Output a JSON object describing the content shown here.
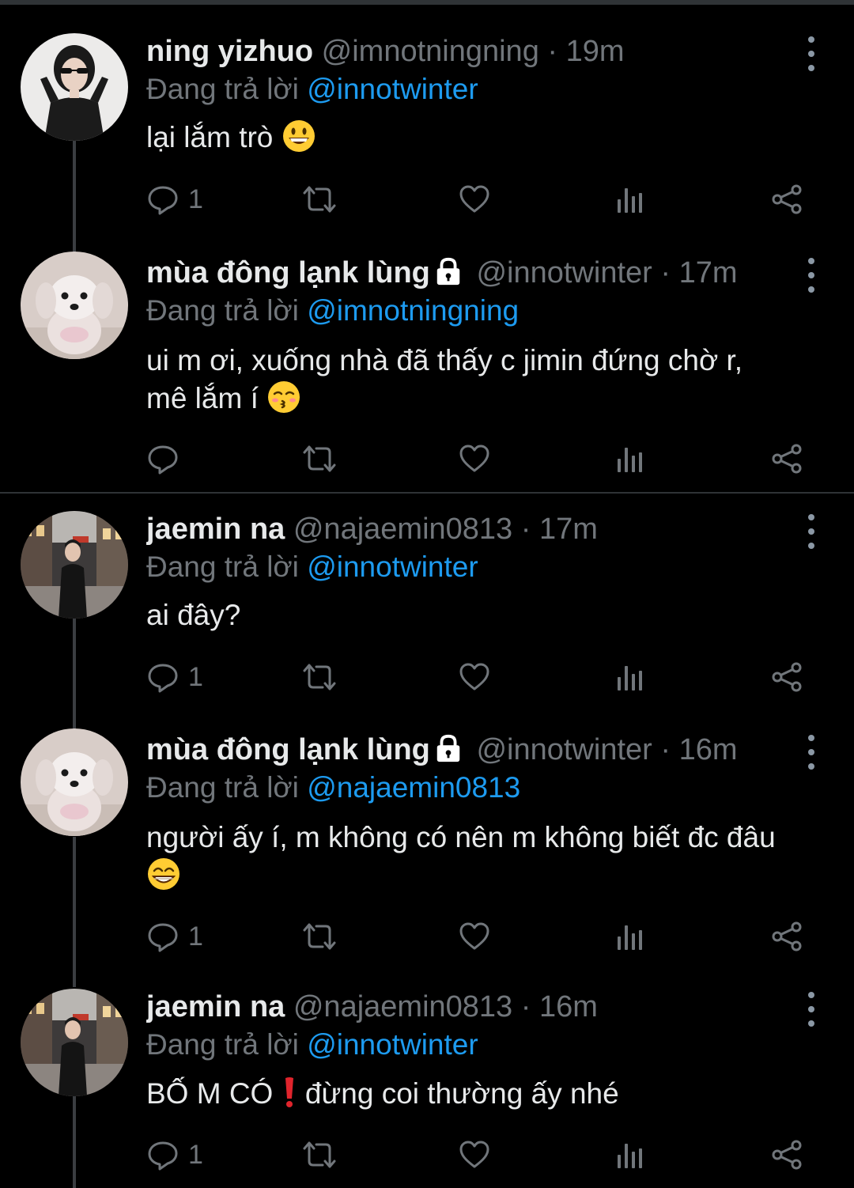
{
  "replying_prefix": "Đang trả lời",
  "colors": {
    "background": "#000000",
    "text": "#e7e9ea",
    "muted": "#71767b",
    "link": "#1d9bf0"
  },
  "tweets": [
    {
      "name": "ning yizhuo",
      "handle": "@imnotningning",
      "separator": "·",
      "time": "19m",
      "locked": false,
      "replying_to": "@innotwinter",
      "text": "lại lắm trò",
      "emoji": "grinning-face-emoji",
      "reply_count": "1",
      "avatar": "girl-sunglasses-avatar"
    },
    {
      "name": "mùa đông lạnk lùng",
      "handle": "@innotwinter",
      "separator": "·",
      "time": "17m",
      "locked": true,
      "replying_to": "@imnotningning",
      "text_line1": "ui m ơi, xuống nhà đã thấy c jimin đứng chờ r,",
      "text_line2": "mê lắm í",
      "emoji": "kissing-face-emoji",
      "reply_count": "",
      "avatar": "white-puppy-avatar"
    },
    {
      "name": "jaemin na",
      "handle": "@najaemin0813",
      "separator": "·",
      "time": "17m",
      "locked": false,
      "replying_to": "@innotwinter",
      "text": "ai đây?",
      "reply_count": "1",
      "avatar": "street-photo-avatar"
    },
    {
      "name": "mùa đông lạnk lùng",
      "handle": "@innotwinter",
      "separator": "·",
      "time": "16m",
      "locked": true,
      "replying_to": "@najaemin0813",
      "text_line1": "người ấy í, m không có nên m không biết đc đâu",
      "emoji": "beaming-face-emoji",
      "reply_count": "1",
      "avatar": "white-puppy-avatar"
    },
    {
      "name": "jaemin na",
      "handle": "@najaemin0813",
      "separator": "·",
      "time": "16m",
      "locked": false,
      "replying_to": "@innotwinter",
      "text_part1": "BỐ M CÓ",
      "text_part2": "đừng coi thường ấy nhé",
      "emoji": "exclamation-mark-emoji",
      "reply_count": "1",
      "avatar": "street-photo-avatar"
    }
  ]
}
